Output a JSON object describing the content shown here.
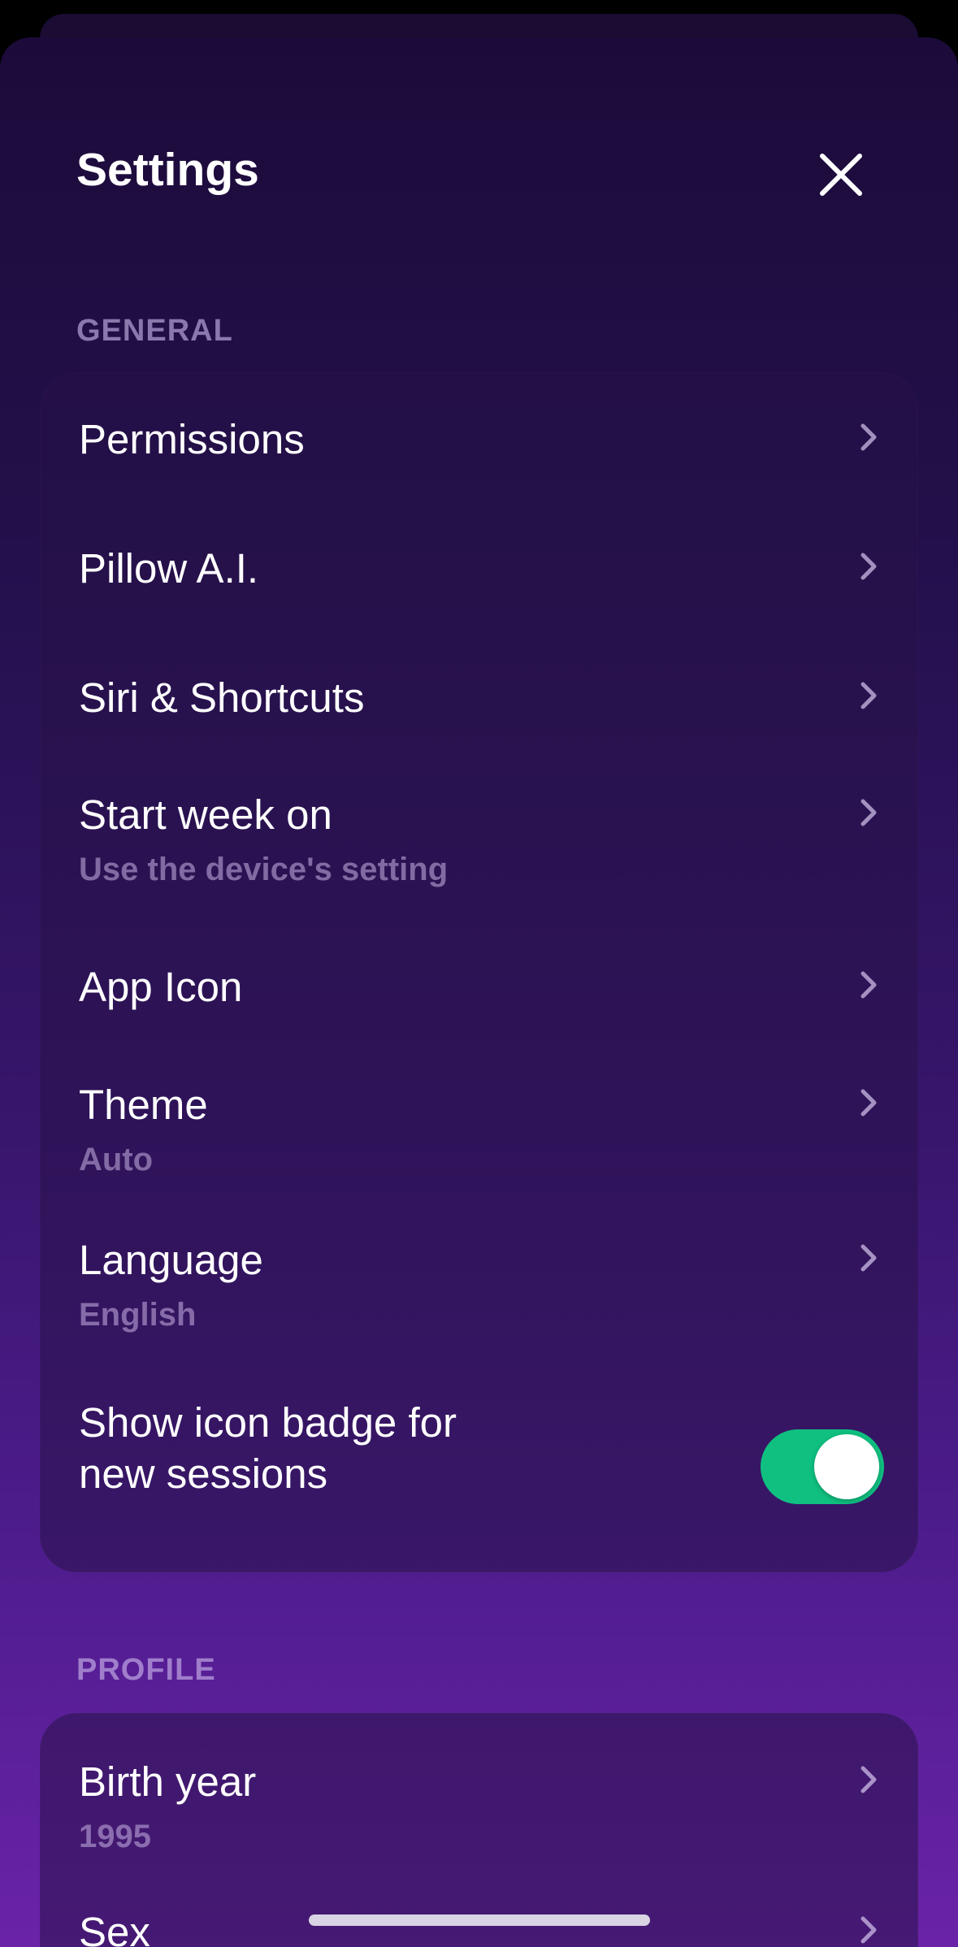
{
  "header": {
    "title": "Settings"
  },
  "icons": {
    "close": "close-icon",
    "chevron": "chevron-right-icon"
  },
  "colors": {
    "toggle_on": "#0fc080",
    "background_top": "#1c0b3a",
    "background_bottom": "#6a23a8"
  },
  "general": {
    "section_label": "GENERAL",
    "items": [
      {
        "label": "Permissions"
      },
      {
        "label": "Pillow A.I."
      },
      {
        "label": "Siri & Shortcuts"
      },
      {
        "label": "Start week on",
        "sub": "Use the device's setting"
      },
      {
        "label": "App Icon"
      },
      {
        "label": "Theme",
        "sub": "Auto"
      },
      {
        "label": "Language",
        "sub": "English"
      }
    ],
    "badge_toggle": {
      "label_line1": "Show icon badge for",
      "label_line2": "new sessions",
      "on": true
    }
  },
  "profile": {
    "section_label": "PROFILE",
    "items": [
      {
        "label": "Birth year",
        "sub": "1995"
      },
      {
        "label": "Sex"
      }
    ]
  }
}
